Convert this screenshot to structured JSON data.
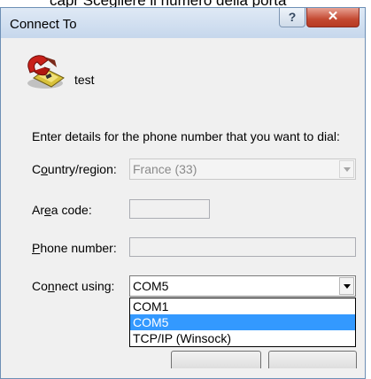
{
  "background_text": "capr Scegliere il numero della porta",
  "window": {
    "title": "Connect To",
    "help_label": "?",
    "close_label": "X"
  },
  "connection": {
    "name": "test"
  },
  "instructions": "Enter details for the phone number that you want to dial:",
  "fields": {
    "country": {
      "label_pre": "C",
      "label_ul": "o",
      "label_post": "untry/region:",
      "value": "France (33)"
    },
    "area_code": {
      "label_pre": "Ar",
      "label_ul": "e",
      "label_post": "a code:",
      "value": ""
    },
    "phone_number": {
      "label_pre": "",
      "label_ul": "P",
      "label_post": "hone number:",
      "value": ""
    },
    "connect_using": {
      "label_pre": "Co",
      "label_ul": "n",
      "label_post": "nect using:",
      "value": "COM5",
      "options": [
        "COM1",
        "COM5",
        "TCP/IP (Winsock)"
      ],
      "selected_index": 1
    }
  },
  "colors": {
    "selection": "#3399ff",
    "close_button": "#c44a32"
  }
}
